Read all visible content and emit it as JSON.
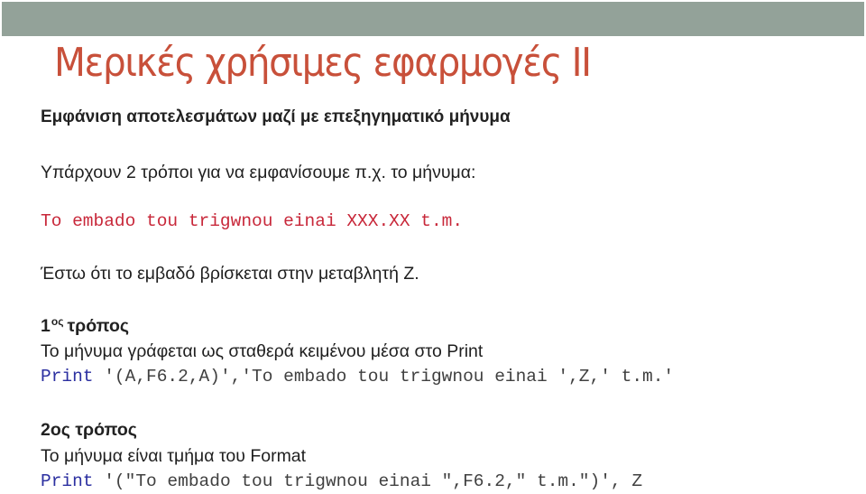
{
  "slide": {
    "title": "Μερικές χρήσιμες εφαρμογές ΙΙ",
    "subtitle": "Εμφάνιση αποτελεσμάτων μαζί με επεξηγηματικό μήνυμα",
    "intro": "Υπάρχουν 2 τρόποι για να εμφανίσουμε π.χ. το μήνυμα:",
    "example_message": "To embado tou trigwnou einai XXX.XX t.m.",
    "assumption": "Έστω ότι το εμβαδό βρίσκεται στην μεταβλητή Z.",
    "method1": {
      "number": "1",
      "suffix": "ος",
      "word": "τρόπος",
      "description": "Το μήνυμα γράφεται ως σταθερά κειμένου μέσα στο Print",
      "code_keyword": "Print",
      "code_rest": " '(A,F6.2,A)','To embado tou trigwnou einai ',Z,' t.m.'"
    },
    "method2": {
      "heading": "2ος τρόπος",
      "description": "Το μήνυμα είναι τμήμα του Format",
      "code_keyword": "Print",
      "code_rest": " '(\"To embado tou trigwnou einai \",F6.2,\" t.m.\")', Z"
    }
  },
  "colors": {
    "banner": "#93a299",
    "title": "#c8503a",
    "example_message": "#c8283a",
    "code_keyword": "#2b2fa0"
  }
}
